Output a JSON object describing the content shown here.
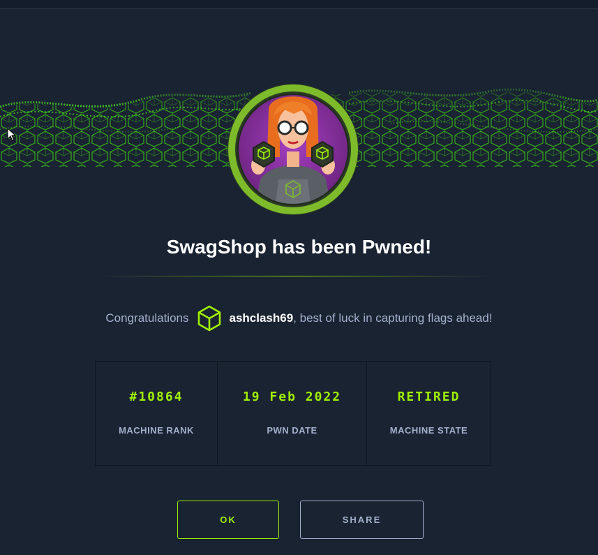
{
  "title": "SwagShop has been Pwned!",
  "congrats": {
    "prefix": "Congratulations",
    "username": "ashclash69",
    "suffix": ", best of luck in capturing flags ahead!"
  },
  "stats": [
    {
      "value": "#10864",
      "label": "MACHINE RANK"
    },
    {
      "value": "19 Feb 2022",
      "label": "PWN DATE"
    },
    {
      "value": "RETIRED",
      "label": "MACHINE STATE"
    }
  ],
  "buttons": {
    "ok": "OK",
    "share": "SHARE"
  },
  "icons": {
    "user_badge": "cube-icon",
    "cursor": "mouse-pointer-icon"
  },
  "colors": {
    "accent": "#9fef00",
    "background": "#1a2332",
    "muted_text": "#a4b1cd",
    "avatar_ring": "#7dbb2a",
    "avatar_bg": "#7a2a8c"
  }
}
